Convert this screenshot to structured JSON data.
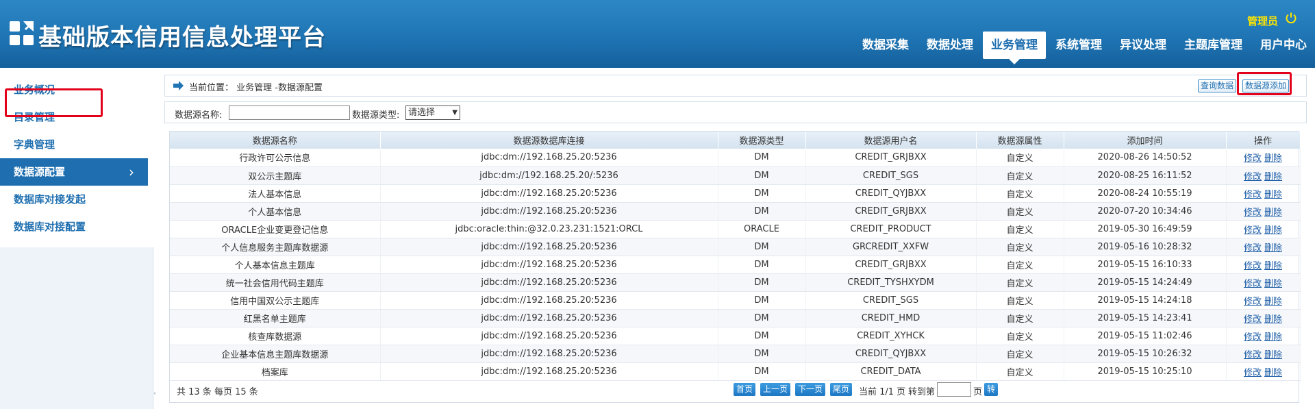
{
  "header": {
    "title": "基础版本信用信息处理平台",
    "user": "管理员",
    "nav": [
      "数据采集",
      "数据处理",
      "业务管理",
      "系统管理",
      "异议处理",
      "主题库管理",
      "用户中心"
    ],
    "active_nav": "业务管理"
  },
  "sidebar": {
    "items": [
      "业务概况",
      "目录管理",
      "字典管理",
      "数据源配置",
      "数据库对接发起",
      "数据库对接配置"
    ],
    "active": "数据源配置"
  },
  "breadcrumb": {
    "text": "当前位置： 业务管理 -数据源配置",
    "query_button": "查询数据",
    "add_button": "数据源添加"
  },
  "filter": {
    "name_label": "数据源名称:",
    "name_value": "",
    "type_label": "数据源类型:",
    "type_value": "请选择"
  },
  "table": {
    "columns": [
      "数据源名称",
      "数据源数据库连接",
      "数据源类型",
      "数据源用户名",
      "数据源属性",
      "添加时间",
      "操作"
    ],
    "actions": [
      "修改",
      "删除"
    ],
    "rows": [
      [
        "行政许可公示信息",
        "jdbc:dm://192.168.25.20:5236",
        "DM",
        "CREDIT_GRJBXX",
        "自定义",
        "2020-08-26 14:50:52"
      ],
      [
        "双公示主题库",
        "jdbc:dm://192.168.25.20/:5236",
        "DM",
        "CREDIT_SGS",
        "自定义",
        "2020-08-25 16:11:52"
      ],
      [
        "法人基本信息",
        "jdbc:dm://192.168.25.20:5236",
        "DM",
        "CREDIT_QYJBXX",
        "自定义",
        "2020-08-24 10:55:19"
      ],
      [
        "个人基本信息",
        "jdbc:dm://192.168.25.20:5236",
        "DM",
        "CREDIT_GRJBXX",
        "自定义",
        "2020-07-20 10:34:46"
      ],
      [
        "ORACLE企业变更登记信息",
        "jdbc:oracle:thin:@32.0.23.231:1521:ORCL",
        "ORACLE",
        "CREDIT_PRODUCT",
        "自定义",
        "2019-05-30 16:49:59"
      ],
      [
        "个人信息服务主题库数据源",
        "jdbc:dm://192.168.25.20:5236",
        "DM",
        "GRCREDIT_XXFW",
        "自定义",
        "2019-05-16 10:28:32"
      ],
      [
        "个人基本信息主题库",
        "jdbc:dm://192.168.25.20:5236",
        "DM",
        "CREDIT_GRJBXX",
        "自定义",
        "2019-05-15 16:10:33"
      ],
      [
        "统一社会信用代码主题库",
        "jdbc:dm://192.168.25.20:5236",
        "DM",
        "CREDIT_TYSHXYDM",
        "自定义",
        "2019-05-15 14:24:49"
      ],
      [
        "信用中国双公示主题库",
        "jdbc:dm://192.168.25.20:5236",
        "DM",
        "CREDIT_SGS",
        "自定义",
        "2019-05-15 14:24:18"
      ],
      [
        "红黑名单主题库",
        "jdbc:dm://192.168.25.20:5236",
        "DM",
        "CREDIT_HMD",
        "自定义",
        "2019-05-15 14:23:41"
      ],
      [
        "核查库数据源",
        "jdbc:dm://192.168.25.20:5236",
        "DM",
        "CREDIT_XYHCK",
        "自定义",
        "2019-05-15 11:02:46"
      ],
      [
        "企业基本信息主题库数据源",
        "jdbc:dm://192.168.25.20:5236",
        "DM",
        "CREDIT_QYJBXX",
        "自定义",
        "2019-05-15 10:26:32"
      ],
      [
        "档案库",
        "jdbc:dm://192.168.25.20:5236",
        "DM",
        "CREDIT_DATA",
        "自定义",
        "2019-05-15 10:25:10"
      ]
    ]
  },
  "pager": {
    "info": "共 13 条  每页 15 条",
    "first": "首页",
    "prev": "上一页",
    "next": "下一页",
    "last": "尾页",
    "current": "当前 1/1 页",
    "goto_label": "转到第",
    "page_unit": "页",
    "go": "转"
  },
  "colors": {
    "header_blue": "#1f75b4",
    "link_blue": "#1f5fa8",
    "highlight_red": "#e3001b",
    "admin_yellow": "#ffe600"
  }
}
